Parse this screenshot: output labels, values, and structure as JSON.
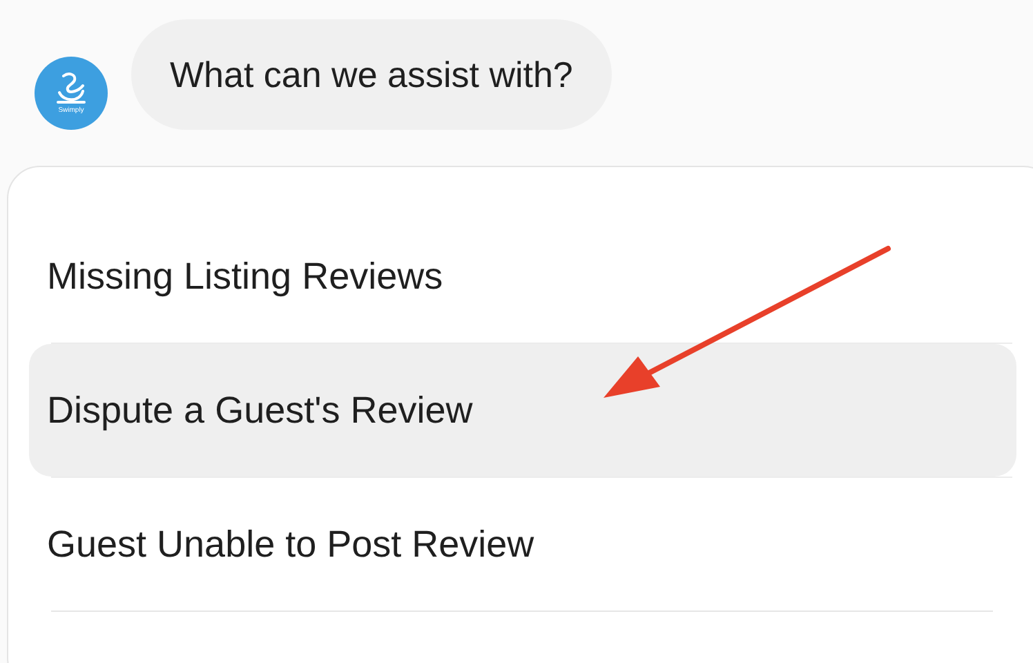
{
  "avatar": {
    "label": "Swimply"
  },
  "message": {
    "text": "What can we assist with?"
  },
  "options": [
    {
      "label": "Missing Listing Reviews",
      "selected": false
    },
    {
      "label": "Dispute a Guest's Review",
      "selected": true
    },
    {
      "label": "Guest Unable to Post Review",
      "selected": false
    }
  ]
}
